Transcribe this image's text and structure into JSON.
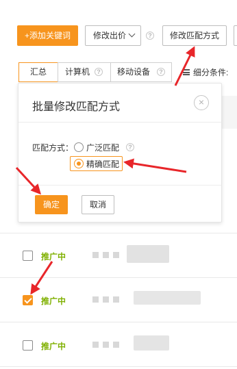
{
  "toolbar": {
    "add_keyword": "+添加关键词",
    "modify_bid": "修改出价",
    "modify_match": "修改匹配方式"
  },
  "tabs": {
    "summary": "汇总",
    "computer": "计算机",
    "mobile": "移动设备",
    "breakdown": "细分条件:"
  },
  "popup": {
    "title": "批量修改匹配方式",
    "match_label": "匹配方式：",
    "option_broad": "广泛匹配",
    "option_exact": "精确匹配",
    "confirm": "确定",
    "cancel": "取消"
  },
  "rows": [
    {
      "status": "推广中",
      "checked": false
    },
    {
      "status": "推广中",
      "checked": true
    },
    {
      "status": "推广中",
      "checked": false
    }
  ],
  "colors": {
    "accent": "#f7941d",
    "status_green": "#7fb000",
    "annotation_red": "#e8262a"
  },
  "icons": [
    "help-icon",
    "chevron-down-icon",
    "list-icon",
    "close-icon",
    "checkmark-icon",
    "arrow-annotation"
  ]
}
